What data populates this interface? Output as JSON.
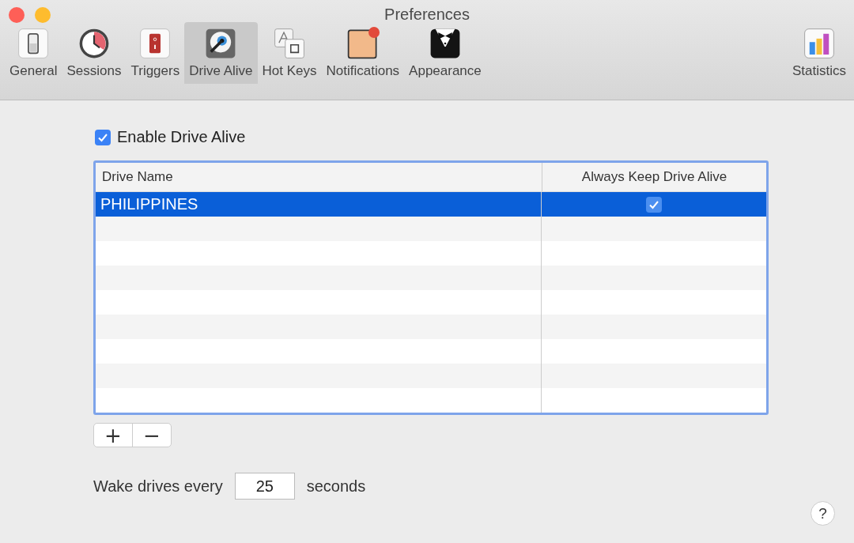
{
  "window": {
    "title": "Preferences"
  },
  "toolbar": {
    "items": [
      {
        "label": "General",
        "selected": false
      },
      {
        "label": "Sessions",
        "selected": false
      },
      {
        "label": "Triggers",
        "selected": false
      },
      {
        "label": "Drive Alive",
        "selected": true
      },
      {
        "label": "Hot Keys",
        "selected": false
      },
      {
        "label": "Notifications",
        "selected": false
      },
      {
        "label": "Appearance",
        "selected": false
      },
      {
        "label": "Statistics",
        "selected": false
      }
    ]
  },
  "enable_checkbox": {
    "label": "Enable Drive Alive",
    "checked": true
  },
  "table": {
    "columns": [
      "Drive Name",
      "Always Keep Drive Alive"
    ],
    "rows": [
      {
        "drive_name": "PHILIPPINES",
        "keep_alive": true,
        "selected": true
      }
    ]
  },
  "add_remove": {
    "add": "+",
    "remove": "−"
  },
  "wake": {
    "label": "Wake drives every",
    "value": "25",
    "unit": "seconds"
  },
  "help": "?"
}
